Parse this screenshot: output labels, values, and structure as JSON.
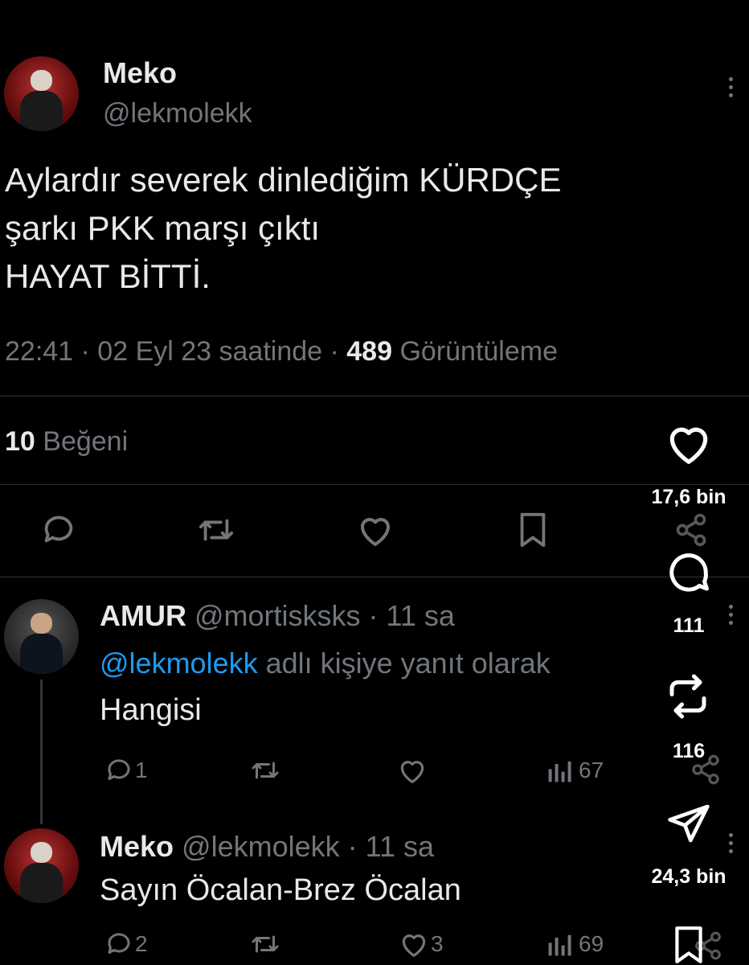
{
  "main_tweet": {
    "name": "Meko",
    "handle": "@lekmolekk",
    "text_line1": "Aylardır severek dinlediğim KÜRDÇE",
    "text_line2": "şarkı PKK marşı çıktı",
    "text_line3": "HAYAT BİTTİ.",
    "time_prefix": "22:41 · 02 Eyl 23 saatinde · ",
    "views_count": "489",
    "views_label": " Görüntüleme",
    "likes_count": "10",
    "likes_label": " Beğeni"
  },
  "reply1": {
    "name": "AMUR",
    "handle_time": "@mortisksks · 11 sa",
    "reply_to_handle": "@lekmolekk",
    "reply_to_suffix": " adlı kişiye yanıt olarak",
    "text": "Hangisi",
    "comments": "1",
    "views": "67"
  },
  "reply2": {
    "name": "Meko",
    "handle_time": "@lekmolekk · 11 sa",
    "text": "Sayın Öcalan-Brez Öcalan",
    "comments": "2",
    "likes": "3",
    "views": "69"
  },
  "rail": {
    "like_count": "17,6 bin",
    "comment_count": "111",
    "repost_count": "116",
    "share_count": "24,3 bin"
  },
  "colors": {
    "background": "#000000",
    "text": "#e7e9ea",
    "muted": "#71767b",
    "link": "#1d9bf0"
  }
}
